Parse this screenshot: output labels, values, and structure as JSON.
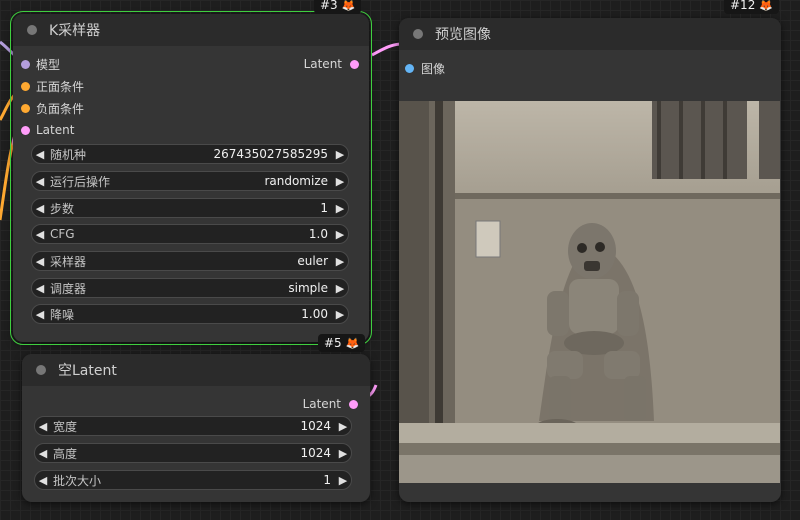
{
  "colors": {
    "model_slot": "#b39ddb",
    "conditioning_slot": "#ffa931",
    "latent_slot": "#ff9cf9",
    "image_slot": "#64b5f6",
    "selected_outline": "#3fcf3f"
  },
  "ksampler": {
    "title": "K采样器",
    "id_badge": "#3",
    "inputs": [
      {
        "label": "模型"
      },
      {
        "label": "正面条件"
      },
      {
        "label": "负面条件"
      },
      {
        "label": "Latent"
      }
    ],
    "output": {
      "label": "Latent"
    },
    "widgets": [
      {
        "label": "随机种",
        "value": "267435027585295"
      },
      {
        "label": "运行后操作",
        "value": "randomize"
      },
      {
        "label": "步数",
        "value": "1"
      },
      {
        "label": "CFG",
        "value": "1.0"
      },
      {
        "label": "采样器",
        "value": "euler"
      },
      {
        "label": "调度器",
        "value": "simple"
      },
      {
        "label": "降噪",
        "value": "1.00"
      }
    ]
  },
  "empty_latent": {
    "title": "空Latent",
    "id_badge": "#5",
    "output": {
      "label": "Latent"
    },
    "widgets": [
      {
        "label": "宽度",
        "value": "1024"
      },
      {
        "label": "高度",
        "value": "1024"
      },
      {
        "label": "批次大小",
        "value": "1"
      }
    ]
  },
  "preview": {
    "title": "预览图像",
    "id_badge": "#12",
    "input": {
      "label": "图像"
    }
  },
  "icons": {
    "badge_icon": "fox-icon",
    "widget_decrement": "left-arrow-icon",
    "widget_increment": "right-arrow-icon"
  }
}
